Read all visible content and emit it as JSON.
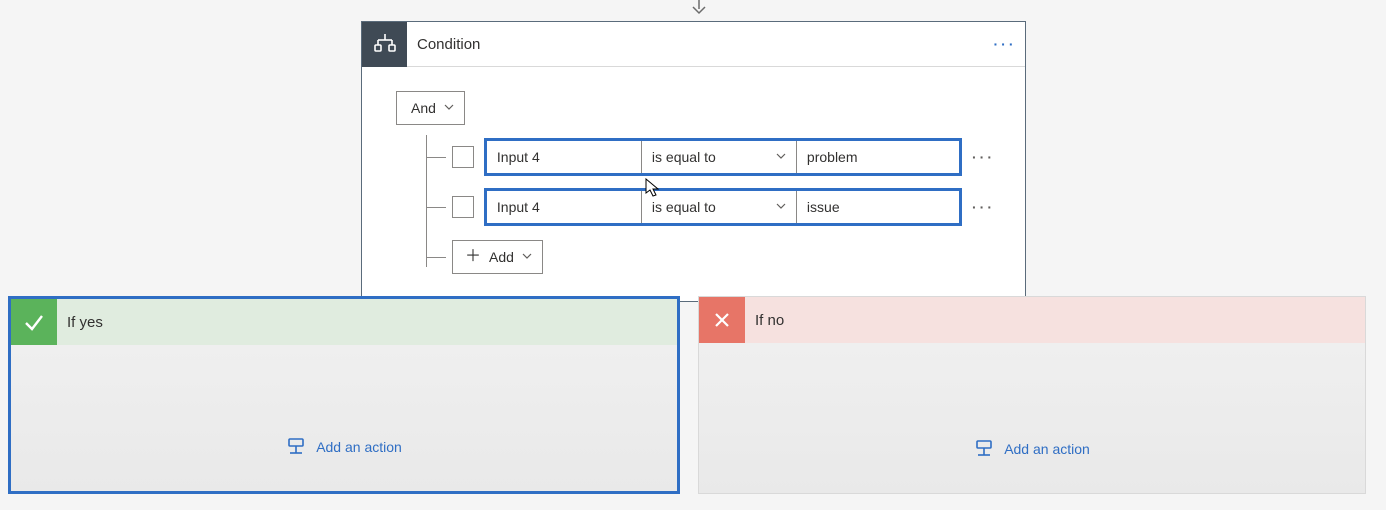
{
  "condition": {
    "title": "Condition",
    "logical_operator": "And",
    "rows": [
      {
        "left": "Input 4",
        "operator": "is equal to",
        "value": "problem"
      },
      {
        "left": "Input 4",
        "operator": "is equal to",
        "value": "issue"
      }
    ],
    "add_label": "Add"
  },
  "branches": {
    "yes": {
      "title": "If yes",
      "add_action_label": "Add an action"
    },
    "no": {
      "title": "If no",
      "add_action_label": "Add an action"
    }
  }
}
